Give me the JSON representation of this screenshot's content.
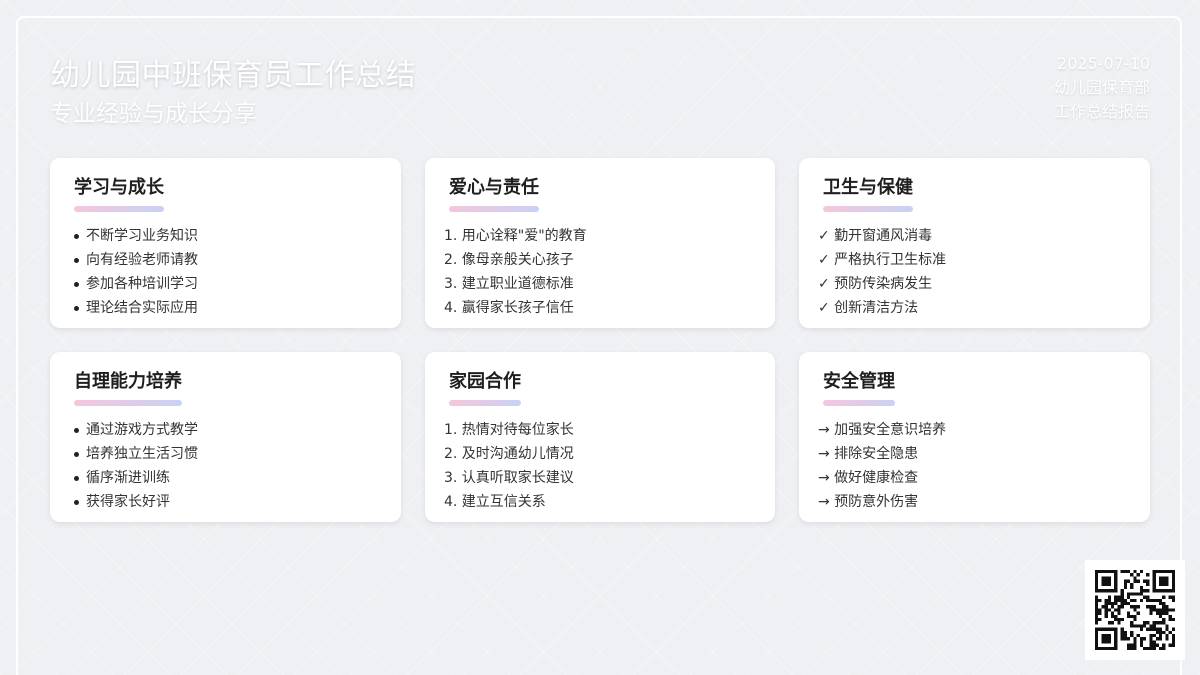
{
  "header": {
    "title": "幼儿园中班保育员工作总结",
    "subtitle": "专业经验与成长分享",
    "date": "2025-07-10",
    "department": "幼儿园保育部",
    "report_type": "工作总结报告"
  },
  "cards": [
    {
      "title": "学习与成长",
      "style": "bullet",
      "items": [
        "不断学习业务知识",
        "向有经验老师请教",
        "参加各种培训学习",
        "理论结合实际应用"
      ]
    },
    {
      "title": "爱心与责任",
      "style": "plain",
      "items": [
        "1. 用心诠释\"爱\"的教育",
        "2. 像母亲般关心孩子",
        "3. 建立职业道德标准",
        "4. 赢得家长孩子信任"
      ]
    },
    {
      "title": "卫生与保健",
      "style": "plain",
      "items": [
        "✓ 勤开窗通风消毒",
        "✓ 严格执行卫生标准",
        "✓ 预防传染病发生",
        "✓ 创新清洁方法"
      ]
    },
    {
      "title": "自理能力培养",
      "style": "bullet",
      "items": [
        "通过游戏方式教学",
        "培养独立生活习惯",
        "循序渐进训练",
        "获得家长好评"
      ]
    },
    {
      "title": "家园合作",
      "style": "plain",
      "items": [
        "1. 热情对待每位家长",
        "2. 及时沟通幼儿情况",
        "3. 认真听取家长建议",
        "4. 建立互信关系"
      ]
    },
    {
      "title": "安全管理",
      "style": "plain",
      "items": [
        "→ 加强安全意识培养",
        "→ 排除安全隐患",
        "→ 做好健康检查",
        "→ 预防意外伤害"
      ]
    }
  ],
  "colors": {
    "background": "#eef0f3",
    "card": "#ffffff",
    "underline_start": "#f5c6dc",
    "underline_end": "#c9d2f5"
  },
  "qr": {
    "icon": "qr-code-icon"
  }
}
